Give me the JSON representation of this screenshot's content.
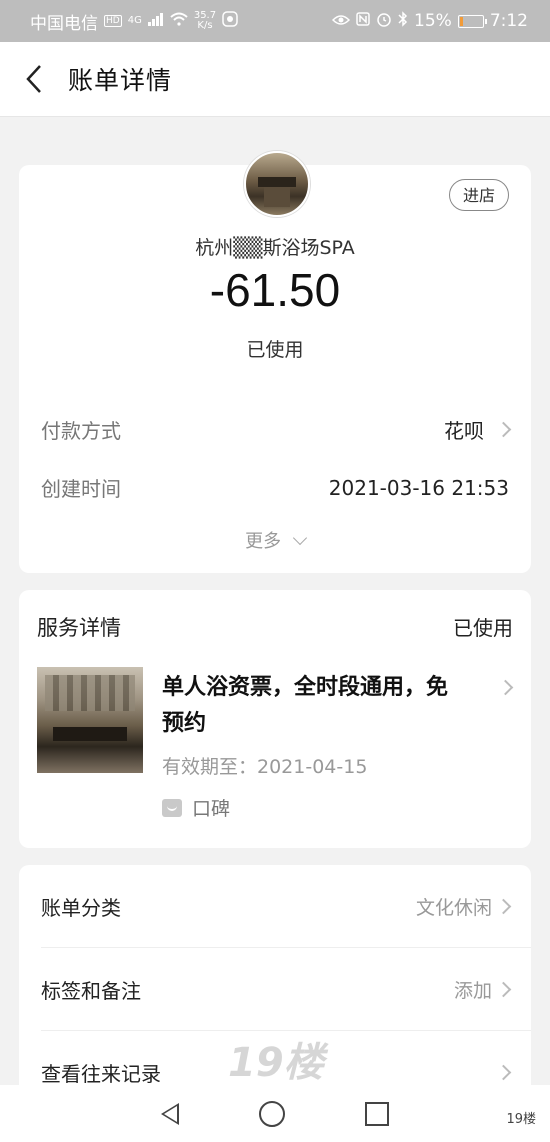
{
  "status_bar": {
    "carrier": "中国电信",
    "hd": "HD",
    "net": "4G",
    "speed_value": "35.7",
    "speed_unit": "K/s",
    "battery": "15%",
    "time": "7:12",
    "battery_color": "#f29b38",
    "battery_level": 0.15
  },
  "header": {
    "title": "账单详情"
  },
  "bill": {
    "store_button": "进店",
    "merchant": "杭州▒▒斯浴场SPA",
    "amount": "-61.50",
    "status": "已使用",
    "payment_label": "付款方式",
    "payment_value": "花呗",
    "created_label": "创建时间",
    "created_value": "2021-03-16 21:53",
    "more": "更多"
  },
  "service": {
    "title": "服务详情",
    "status": "已使用",
    "name": "单人浴资票，全时段通用，免预约",
    "expiry": "有效期至：2021-04-15",
    "tag": "口碑"
  },
  "list": [
    {
      "label": "账单分类",
      "value": "文化休闲"
    },
    {
      "label": "标签和备注",
      "value": "添加"
    },
    {
      "label": "查看往来记录",
      "value": ""
    }
  ],
  "watermark": "19楼",
  "corner_mark": "19楼"
}
